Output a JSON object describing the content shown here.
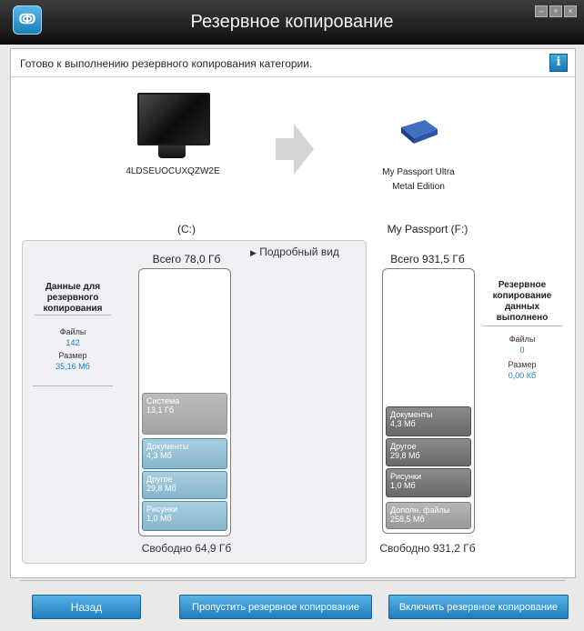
{
  "window": {
    "title": "Резервное копирование",
    "app_icon": "wd-backup-app-icon",
    "buttons": [
      "minimize",
      "maximize",
      "close"
    ]
  },
  "status": {
    "text": "Готово к выполнению резервного копирования категории.",
    "info_icon": "i"
  },
  "source": {
    "computer_name": "4LDSEUOCUXQZW2E",
    "volume": "(C:)",
    "total": "Всего 78,0 Гб",
    "detail_link": "Подробный вид",
    "free": "Свободно 64,9 Гб",
    "segments": [
      {
        "name": "Система",
        "size": "13,1 Гб"
      },
      {
        "name": "Документы",
        "size": "4,3 Мб"
      },
      {
        "name": "Другое",
        "size": "29,8 Мб"
      },
      {
        "name": "Рисунки",
        "size": "1,0 Мб"
      }
    ],
    "side": {
      "heading": "Данные для резервного копирования",
      "files_label": "Файлы",
      "files_value": "142",
      "size_label": "Размер",
      "size_value": "35,16 Мб"
    }
  },
  "destination": {
    "drive_name_line1": "My Passport Ultra",
    "drive_name_line2": "Metal Edition",
    "volume": "My Passport (F:)",
    "total": "Всего 931,5 Гб",
    "free": "Свободно 931,2 Гб",
    "segments": [
      {
        "name": "Документы",
        "size": "4,3 Мб"
      },
      {
        "name": "Другое",
        "size": "29,8 Мб"
      },
      {
        "name": "Рисунки",
        "size": "1,0 Мб"
      },
      {
        "name": "Дополн. файлы",
        "size": "258,5 Мб"
      }
    ],
    "side": {
      "heading": "Резервное копирование данных выполнено",
      "files_label": "Файлы",
      "files_value": "0",
      "size_label": "Размер",
      "size_value": "0,00 Кб"
    }
  },
  "buttons": {
    "back": "Назад",
    "skip": "Пропустить резервное копирование",
    "enable": "Включить резервное копирование"
  }
}
